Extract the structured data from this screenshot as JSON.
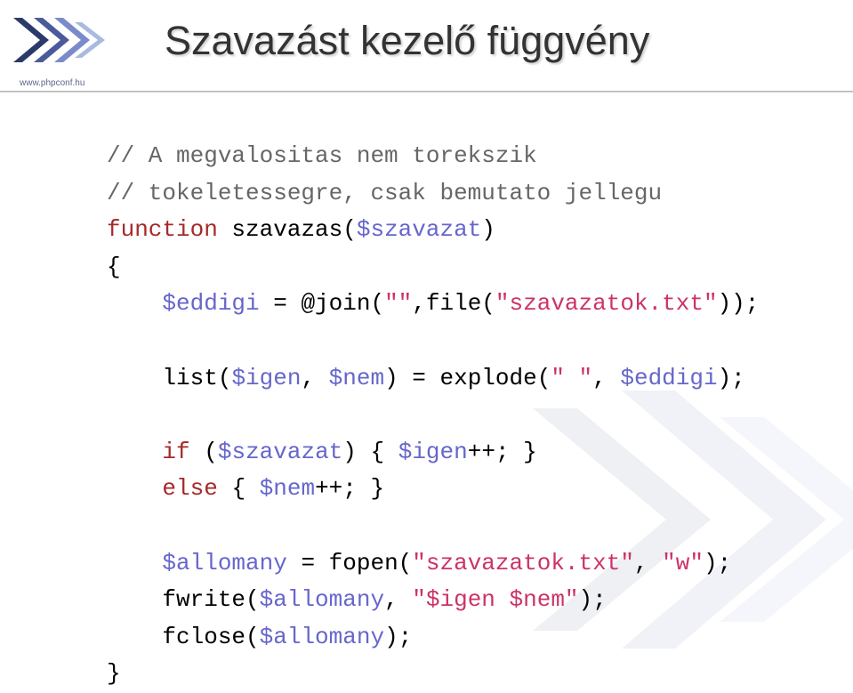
{
  "header": {
    "title": "Szavazást kezelő függvény",
    "url": "www.phpconf.hu"
  },
  "code": {
    "comment1": "// A megvalositas nem torekszik",
    "comment2": "// tokeletessegre, csak bemutato jellegu",
    "func_keyword": "function",
    "func_name": " szavazas(",
    "func_param": "$szavazat",
    "func_close": ")",
    "brace_open": "{",
    "line1_indent": "    ",
    "line1_var": "$eddigi",
    "line1_assign": " = @join(",
    "line1_str1": "\"\"",
    "line1_mid": ",file(",
    "line1_str2": "\"szavazatok.txt\"",
    "line1_end": "));",
    "line2_indent": "    ",
    "line2_pre": "list(",
    "line2_var1": "$igen",
    "line2_comma": ", ",
    "line2_var2": "$nem",
    "line2_mid": ") = explode(",
    "line2_str": "\" \"",
    "line2_comma2": ", ",
    "line2_var3": "$eddigi",
    "line2_end": ");",
    "line3_indent": "    ",
    "line3_if": "if",
    "line3_open": " (",
    "line3_var": "$szavazat",
    "line3_mid": ") { ",
    "line3_var2": "$igen",
    "line3_end": "++; }",
    "line4_indent": "    ",
    "line4_else": "else",
    "line4_open": " { ",
    "line4_var": "$nem",
    "line4_end": "++; }",
    "line5_indent": "    ",
    "line5_var": "$allomany",
    "line5_assign": " = fopen(",
    "line5_str1": "\"szavazatok.txt\"",
    "line5_comma": ", ",
    "line5_str2": "\"w\"",
    "line5_end": ");",
    "line6_indent": "    ",
    "line6_func": "fwrite(",
    "line6_var": "$allomany",
    "line6_comma": ", ",
    "line6_str": "\"$igen $nem\"",
    "line6_end": ");",
    "line7_indent": "    ",
    "line7_func": "fclose(",
    "line7_var": "$allomany",
    "line7_end": ");",
    "brace_close": "}"
  }
}
